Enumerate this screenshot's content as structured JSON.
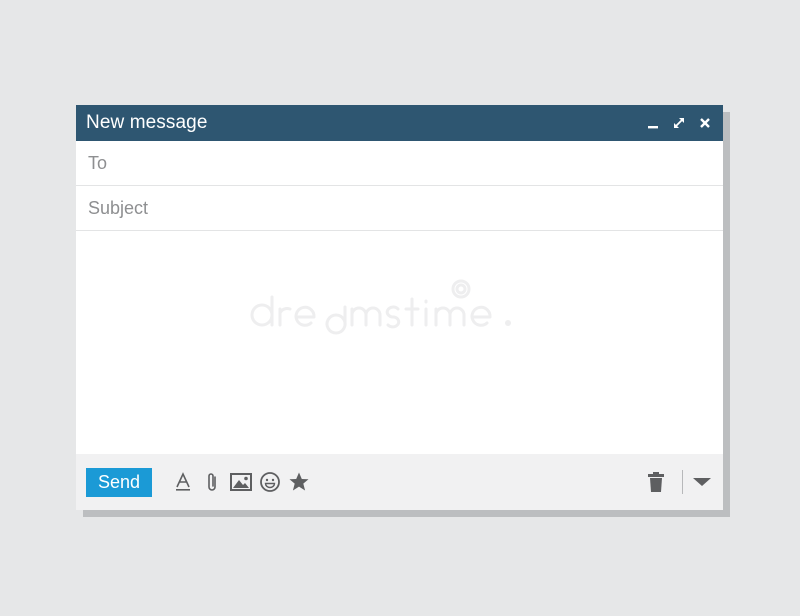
{
  "window": {
    "title": "New message"
  },
  "fields": {
    "to_placeholder": "To",
    "subject_placeholder": "Subject"
  },
  "footer": {
    "send_label": "Send"
  },
  "colors": {
    "titlebar": "#2e5671",
    "send_button": "#1b9ad6",
    "footer": "#f1f1f2",
    "icon": "#5e5f61"
  },
  "icons": {
    "window_controls": [
      "minimize-icon",
      "expand-icon",
      "close-icon"
    ],
    "toolbar": [
      "text-format-icon",
      "attachment-icon",
      "image-icon",
      "emoji-icon",
      "star-icon"
    ],
    "actions": [
      "trash-icon",
      "chevron-down-icon"
    ]
  }
}
